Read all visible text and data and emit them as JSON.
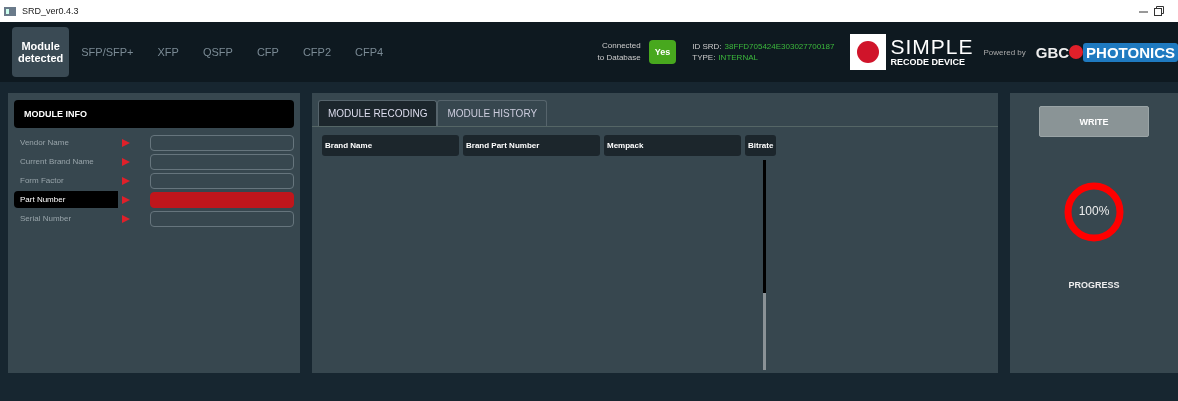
{
  "window": {
    "title": "SRD_ver0.4.3"
  },
  "tabs": [
    {
      "label": "Module\ndetected",
      "selected": true
    },
    {
      "label": "SFP/SFP+",
      "selected": false
    },
    {
      "label": "XFP",
      "selected": false
    },
    {
      "label": "QSFP",
      "selected": false
    },
    {
      "label": "CFP",
      "selected": false
    },
    {
      "label": "CFP2",
      "selected": false
    },
    {
      "label": "CFP4",
      "selected": false
    }
  ],
  "database": {
    "label": "Connected\nto Database",
    "status": "Yes",
    "connected": true
  },
  "device": {
    "id_label": "ID SRD:",
    "id": "38FFD705424E303027700187",
    "type_label": "TYPE:",
    "type": "INTERNAL"
  },
  "logo": {
    "line1": "SIMPLE",
    "line2": "RECODE DEVICE",
    "powered_by": "Powered by",
    "brand1": "GBC",
    "brand2": "PHOTONICS"
  },
  "module_info": {
    "title": "MODULE INFO",
    "fields": [
      {
        "label": "Vendor Name",
        "selected": false
      },
      {
        "label": "Current Brand Name",
        "selected": false
      },
      {
        "label": "Form Factor",
        "selected": false
      },
      {
        "label": "Part Number",
        "selected": true
      },
      {
        "label": "Serial Number",
        "selected": false
      }
    ]
  },
  "main_tabs": [
    {
      "label": "MODULE RECODING",
      "selected": true
    },
    {
      "label": "MODULE HISTORY",
      "selected": false
    }
  ],
  "table": {
    "columns": [
      "Brand Name",
      "Brand Part Number",
      "Mempack",
      "Bitrate"
    ]
  },
  "write_button": "WRITE",
  "progress": {
    "reading": "100%",
    "label": "PROGRESS"
  }
}
